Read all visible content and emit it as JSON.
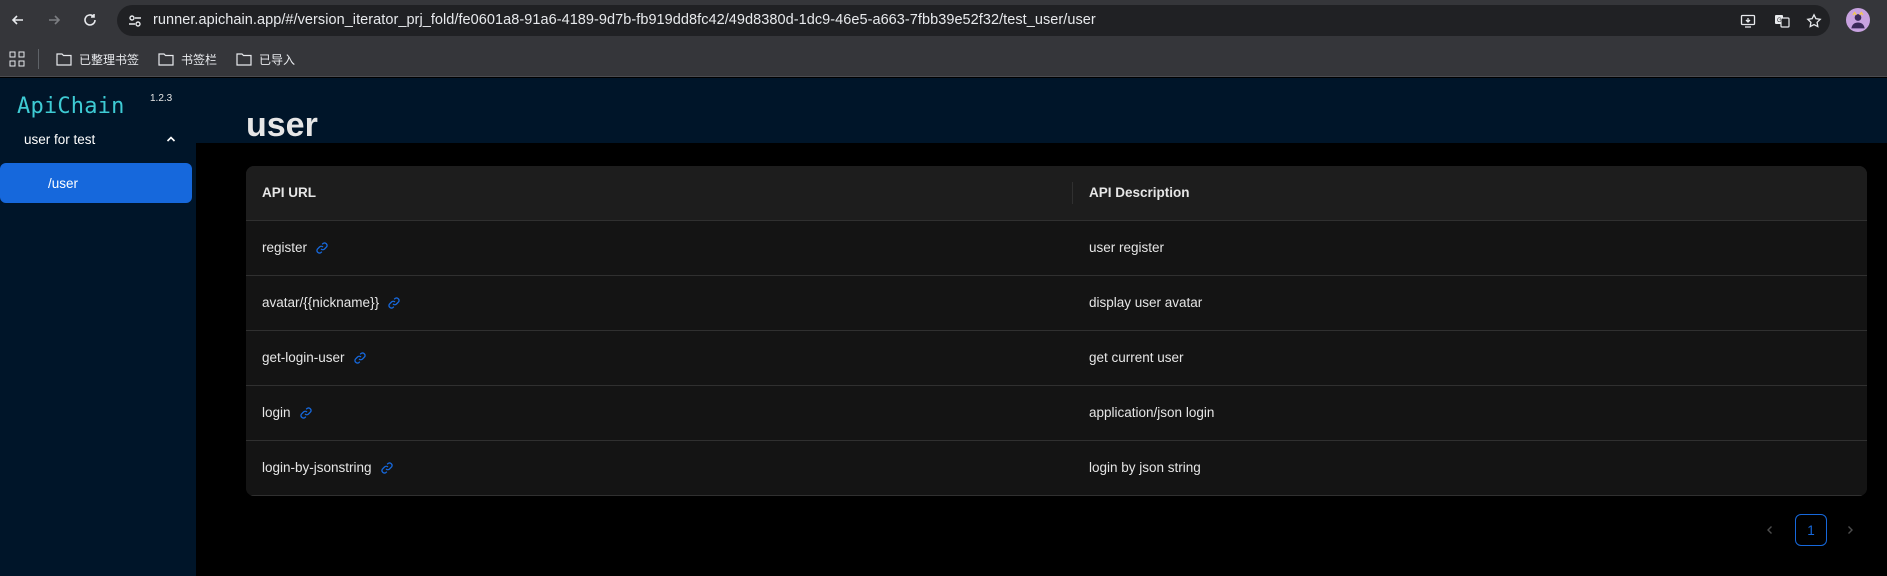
{
  "browser": {
    "url": "runner.apichain.app/#/version_iterator_prj_fold/fe0601a8-91a6-4189-9d7b-fb919dd8fc42/49d8380d-1dc9-46e5-a663-7fbb39e52f32/test_user/user",
    "bookmarks": [
      {
        "label": "已整理书签"
      },
      {
        "label": "书签栏"
      },
      {
        "label": "已导入"
      }
    ]
  },
  "app": {
    "logo": "ApiChain",
    "version": "1.2.3",
    "sidebar": {
      "group_label": "user for test",
      "items": [
        {
          "label": "/user"
        }
      ]
    },
    "page_title": "user",
    "table": {
      "columns": [
        "API URL",
        "API Description"
      ],
      "rows": [
        {
          "url": "register",
          "description": "user register"
        },
        {
          "url": "avatar/{{nickname}}",
          "description": "display user avatar"
        },
        {
          "url": "get-login-user",
          "description": "get current user"
        },
        {
          "url": "login",
          "description": "application/json login"
        },
        {
          "url": "login-by-jsonstring",
          "description": "login by json string"
        }
      ]
    },
    "pagination": {
      "current": "1"
    },
    "colors": {
      "accent": "#1668dc",
      "logo": "#3ecbd4",
      "sidebar_bg": "#001529"
    }
  }
}
